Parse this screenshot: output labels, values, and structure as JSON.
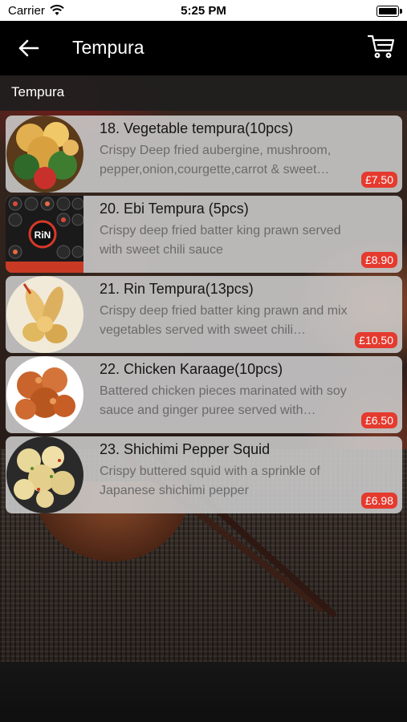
{
  "status_bar": {
    "carrier": "Carrier",
    "time": "5:25 PM"
  },
  "nav": {
    "title": "Tempura",
    "back_icon": "arrow-left-icon",
    "cart_icon": "cart-icon"
  },
  "category": {
    "label": "Tempura"
  },
  "items": [
    {
      "title": "18. Vegetable tempura(10pcs)",
      "description": "Crispy Deep fried aubergine, mushroom, pepper,onion,courgette,carrot & sweet…",
      "price": "£7.50"
    },
    {
      "title": "20. Ebi Tempura (5pcs)",
      "description": "Crispy deep fried batter king prawn served with sweet chili sauce",
      "price": "£8.90"
    },
    {
      "title": "21. Rin Tempura(13pcs)",
      "description": "Crispy deep fried batter king prawn and mix vegetables served with sweet chili…",
      "price": "£10.50"
    },
    {
      "title": "22. Chicken Karaage(10pcs)",
      "description": "Battered chicken pieces marinated with soy sauce and ginger puree served with…",
      "price": "£6.50"
    },
    {
      "title": "23. Shichimi Pepper Squid",
      "description": "Crispy buttered squid with a sprinkle of Japanese shichimi pepper",
      "price": "£6.98"
    }
  ],
  "logo_text": "RiN",
  "colors": {
    "price_badge": "#e53a2e",
    "nav_bg": "#000000"
  }
}
